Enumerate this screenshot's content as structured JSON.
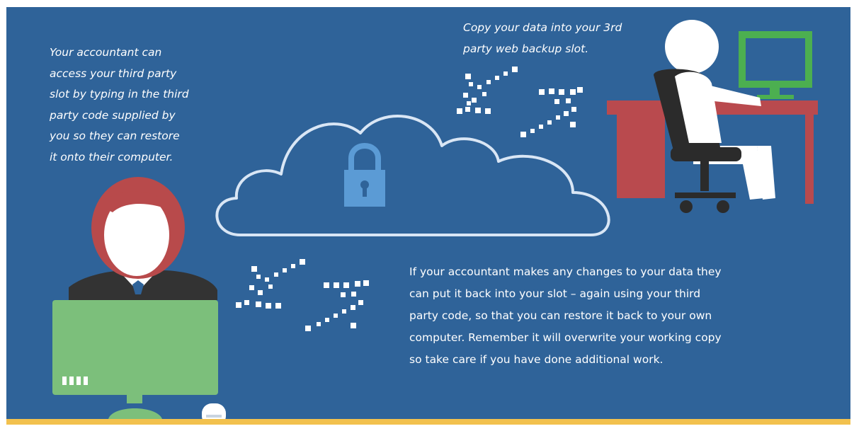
{
  "illustration": {
    "colors": {
      "background": "#2f6399",
      "ground": "#f2c14e",
      "accountant_hair": "#b84a4b",
      "monitor": "#7cbf7b",
      "user_monitor": "#4caf50",
      "desk": "#b94a4e",
      "chair": "#2b2b2b",
      "cloud_outline": "#d9e6f5",
      "lock": "#5b9bd5"
    },
    "icons": [
      "accountant-icon",
      "cloud-icon",
      "padlock-icon",
      "user-at-desk-icon",
      "data-transfer-arrows-icon"
    ]
  },
  "captions": {
    "accountant": [
      "Your accountant can",
      "access your third party",
      "slot by typing in the third",
      "party code supplied by",
      "you so they can restore",
      "it onto their computer."
    ],
    "copy": [
      "Copy your data into your 3rd",
      "party web backup slot."
    ],
    "changes": [
      "If your accountant makes any changes to your data they",
      "can put it back into your slot – again using your third",
      "party code, so that you can restore it back to your own",
      "computer. Remember it will overwrite your working copy",
      "so take care if you have done additional work."
    ]
  }
}
